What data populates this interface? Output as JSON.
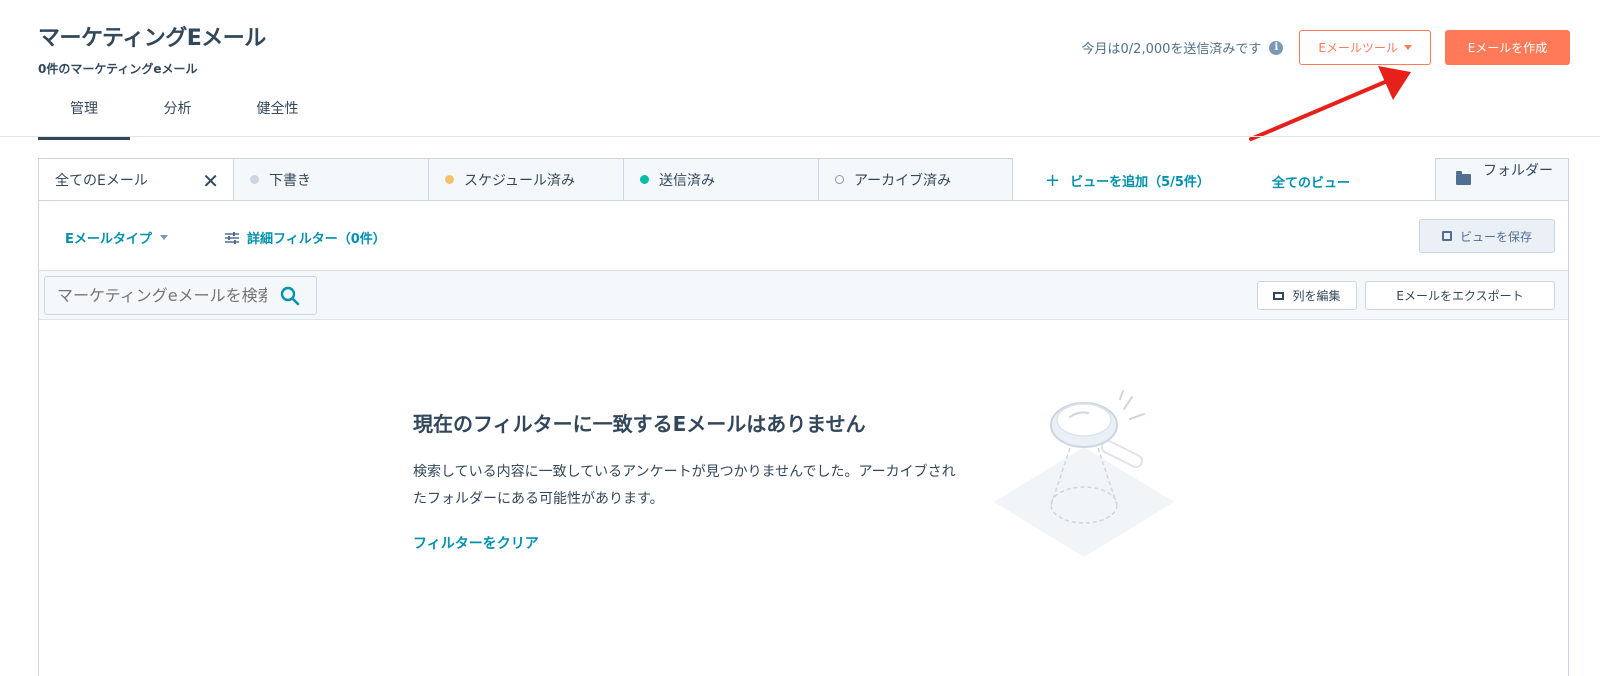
{
  "header": {
    "title": "マーケティングEメール",
    "subtitle": "0件のマーケティングeメール",
    "send_count": "今月は0/2,000を送信済みです",
    "info_icon": "info-icon",
    "tools_button": "Eメールツール",
    "create_button": "Eメールを作成"
  },
  "main_tabs": [
    {
      "label": "管理",
      "active": true
    },
    {
      "label": "分析",
      "active": false
    },
    {
      "label": "健全性",
      "active": false
    }
  ],
  "view_tabs": [
    {
      "label": "全てのEメール",
      "dot_color": null,
      "active": true
    },
    {
      "label": "下書き",
      "dot_color": "#cbd6e2",
      "active": false
    },
    {
      "label": "スケジュール済み",
      "dot_color": "#f5c26b",
      "active": false
    },
    {
      "label": "送信済み",
      "dot_color": "#00bda5",
      "active": false
    },
    {
      "label": "アーカイブ済み",
      "dot_color": "#ffffff",
      "active": false
    }
  ],
  "view_actions": {
    "add_view": "ビューを追加（5/5件）",
    "all_views": "全てのビュー",
    "folder": "フォルダー"
  },
  "filters": {
    "email_type": "Eメールタイプ",
    "advanced": "詳細フィルター（0件）",
    "save_view": "ビューを保存"
  },
  "table_toolbar": {
    "search_placeholder": "マーケティングeメールを検索",
    "edit_columns": "列を編集",
    "export": "Eメールをエクスポート"
  },
  "empty_state": {
    "title": "現在のフィルターに一致するEメールはありません",
    "description": "検索している内容に一致しているアンケートが見つかりませんでした。アーカイブされたフォルダーにある可能性があります。",
    "clear_link": "フィルターをクリア"
  },
  "colors": {
    "accent": "#ff7a59",
    "link": "#0091ae",
    "text": "#33475b",
    "annotation_arrow": "#e8201a"
  }
}
